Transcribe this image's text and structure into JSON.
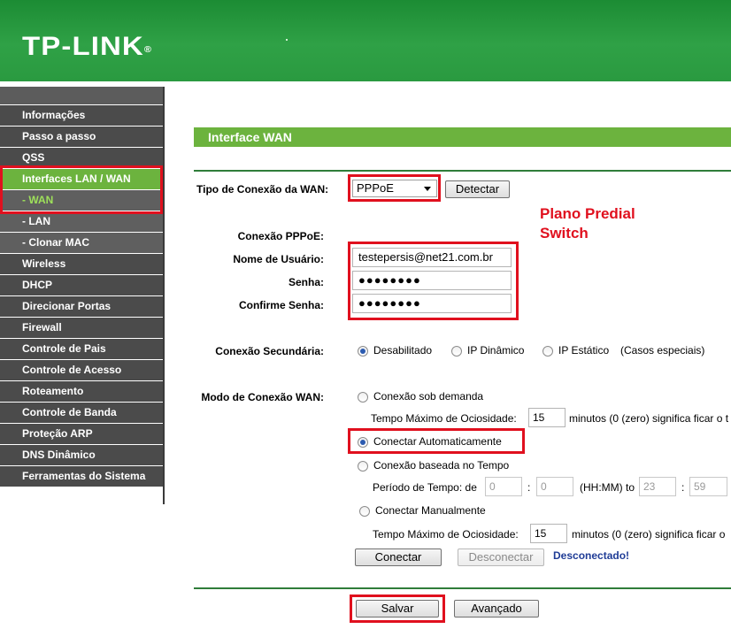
{
  "header": {
    "brand": "TP-LINK",
    "registered": "®"
  },
  "sidebar": {
    "items": [
      {
        "label": "Informações",
        "state": "normal"
      },
      {
        "label": "Passo a passo",
        "state": "normal"
      },
      {
        "label": "QSS",
        "state": "normal"
      },
      {
        "label": "Interfaces LAN / WAN",
        "state": "active"
      },
      {
        "label": "- WAN",
        "state": "subactive"
      },
      {
        "label": "- LAN",
        "state": "sub"
      },
      {
        "label": "- Clonar MAC",
        "state": "sub"
      },
      {
        "label": "Wireless",
        "state": "normal"
      },
      {
        "label": "DHCP",
        "state": "normal"
      },
      {
        "label": "Direcionar Portas",
        "state": "normal"
      },
      {
        "label": "Firewall",
        "state": "normal"
      },
      {
        "label": "Controle de Pais",
        "state": "normal"
      },
      {
        "label": "Controle de Acesso",
        "state": "normal"
      },
      {
        "label": "Roteamento",
        "state": "normal"
      },
      {
        "label": "Controle de Banda",
        "state": "normal"
      },
      {
        "label": "Proteção ARP",
        "state": "normal"
      },
      {
        "label": "DNS Dinâmico",
        "state": "normal"
      },
      {
        "label": "Ferramentas do Sistema",
        "state": "normal"
      }
    ]
  },
  "main": {
    "title": "Interface WAN",
    "connection_type": {
      "label": "Tipo de Conexão da WAN:",
      "value": "PPPoE",
      "detect_label": "Detectar"
    },
    "annotation": {
      "line1": "Plano Predial",
      "line2": "Switch"
    },
    "pppoe": {
      "section_label": "Conexão PPPoE:",
      "username_label": "Nome de Usuário:",
      "username_value": "testepersis@net21.com.br",
      "password_label": "Senha:",
      "password_value": "●●●●●●●●",
      "confirm_label": "Confirme Senha:",
      "confirm_value": "●●●●●●●●"
    },
    "secondary": {
      "label": "Conexão Secundária:",
      "options": [
        "Desabilitado",
        "IP Dinâmico",
        "IP Estático"
      ],
      "selected": "Desabilitado",
      "note": "(Casos especiais)"
    },
    "mode": {
      "label": "Modo de Conexão WAN:",
      "on_demand": "Conexão sob demanda",
      "idle_label": "Tempo Máximo de Ociosidade:",
      "idle_value": "15",
      "idle_note": "minutos (0 (zero) significa ficar o t",
      "auto": "Conectar Automaticamente",
      "time_based": "Conexão baseada no Tempo",
      "period_label": "Período de Tempo: de",
      "period_from_h": "0",
      "period_from_m": "0",
      "period_format": "(HH:MM) to",
      "period_to_h": "23",
      "period_to_m": "59",
      "manual": "Conectar Manualmente",
      "idle2_label": "Tempo Máximo de Ociosidade:",
      "idle2_value": "15",
      "idle2_note": "minutos (0 (zero) significa ficar o",
      "selected": "Conectar Automaticamente"
    },
    "connect_label": "Conectar",
    "disconnect_label": "Desconectar",
    "status": "Desconectado!",
    "save_label": "Salvar",
    "advanced_label": "Avançado",
    "colors": {
      "brand_green": "#2fa146",
      "menu_active": "#6cb33e",
      "highlight_red": "#e0101e",
      "status_blue": "#1f3c96"
    }
  }
}
